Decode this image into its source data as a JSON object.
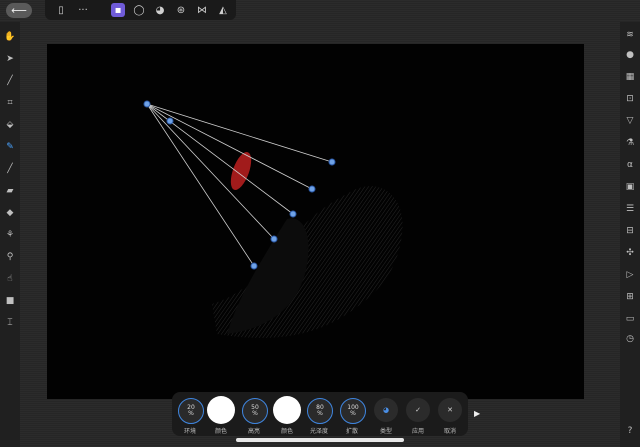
{
  "toolbar": {
    "back_icon": "arrow-left-icon",
    "items": [
      "document-icon",
      "more-icon",
      "pixel-persona-icon",
      "photo-persona-icon",
      "liquify-persona-icon",
      "develop-persona-icon",
      "tone-map-persona-icon",
      "export-persona-icon"
    ]
  },
  "canvas": {
    "background": "#020202",
    "gradient_line_color": "#cfcfcf",
    "node_color": "#6fa2e6"
  },
  "context_toolbar": {
    "ambient": {
      "value": "20",
      "unit": "%",
      "label": "环境"
    },
    "ambient_color_label": "颜色",
    "diffuse": {
      "value": "50",
      "unit": "%",
      "label": "高亮"
    },
    "light_color_label": "颜色",
    "specular": {
      "value": "80",
      "unit": "%",
      "label": "光泽度"
    },
    "spread": {
      "value": "100",
      "unit": "%",
      "label": "扩散"
    },
    "type_label": "类型",
    "apply_label": "应用",
    "cancel_label": "取消"
  }
}
